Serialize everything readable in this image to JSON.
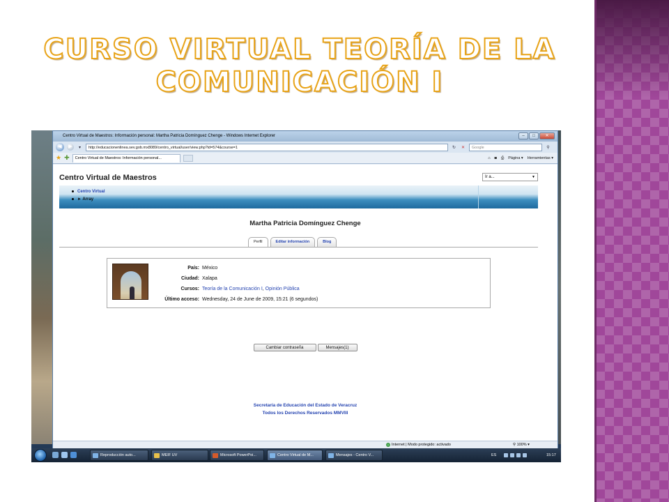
{
  "slide": {
    "title_line1": "Curso virtual Teoría de la",
    "title_line2": "Comunicación I"
  },
  "browser": {
    "window_title": "Centro Virtual de Maestros: Información personal: Martha Patricia Domínguez Chenge - Windows Internet Explorer",
    "url": "http://educacionenlinea.sev.gob.mx8089/centro_virtual/user/view.php?id=574&course=1",
    "search_placeholder": "Google",
    "tab_title": "Centro Virtual de Maestros: Información personal...",
    "commands": {
      "page": "Página ▾",
      "tools": "Herramientas ▾"
    },
    "status_text": "Internet | Modo protegido: activado",
    "zoom": "100%"
  },
  "page": {
    "site_title": "Centro Virtual de Maestros",
    "goto_select": "Ir a...",
    "breadcrumb": {
      "home": "Centro Virtual",
      "current": "► Array"
    },
    "user_name": "Martha Patricia Domínguez Chenge",
    "tabs": {
      "profile": "Perfil",
      "edit": "Editar información",
      "blog": "Blog"
    },
    "profile": {
      "country_label": "País:",
      "country_value": "México",
      "city_label": "Ciudad:",
      "city_value": "Xalapa",
      "courses_label": "Cursos:",
      "course_1": "Teoría de la Comunicación I",
      "course_sep": ", ",
      "course_2": "Opinión Pública",
      "last_access_label": "Último acceso:",
      "last_access_value": "Wednesday, 24 de June de 2009, 15:21  (6 segundos)"
    },
    "buttons": {
      "change_password": "Cambiar contraseña",
      "messages": "Mensajes(1)"
    },
    "footer": {
      "line1": "Secretaría de Educación del Estado de Veracruz",
      "line2": "Todos los Derechos Reservados MMVIII"
    }
  },
  "taskbar": {
    "items": [
      "Reproducción auto...",
      "MEIF UV",
      "Microsoft PowerPoi...",
      "Centro Virtual de M...",
      "Mensajes - Centro V..."
    ],
    "language": "ES",
    "clock": "15:17"
  },
  "colors": {
    "title_outline": "#e8a317",
    "side_panel": "#a0479a",
    "link": "#2443b0",
    "navbar_blue": "#1e6a9e"
  }
}
